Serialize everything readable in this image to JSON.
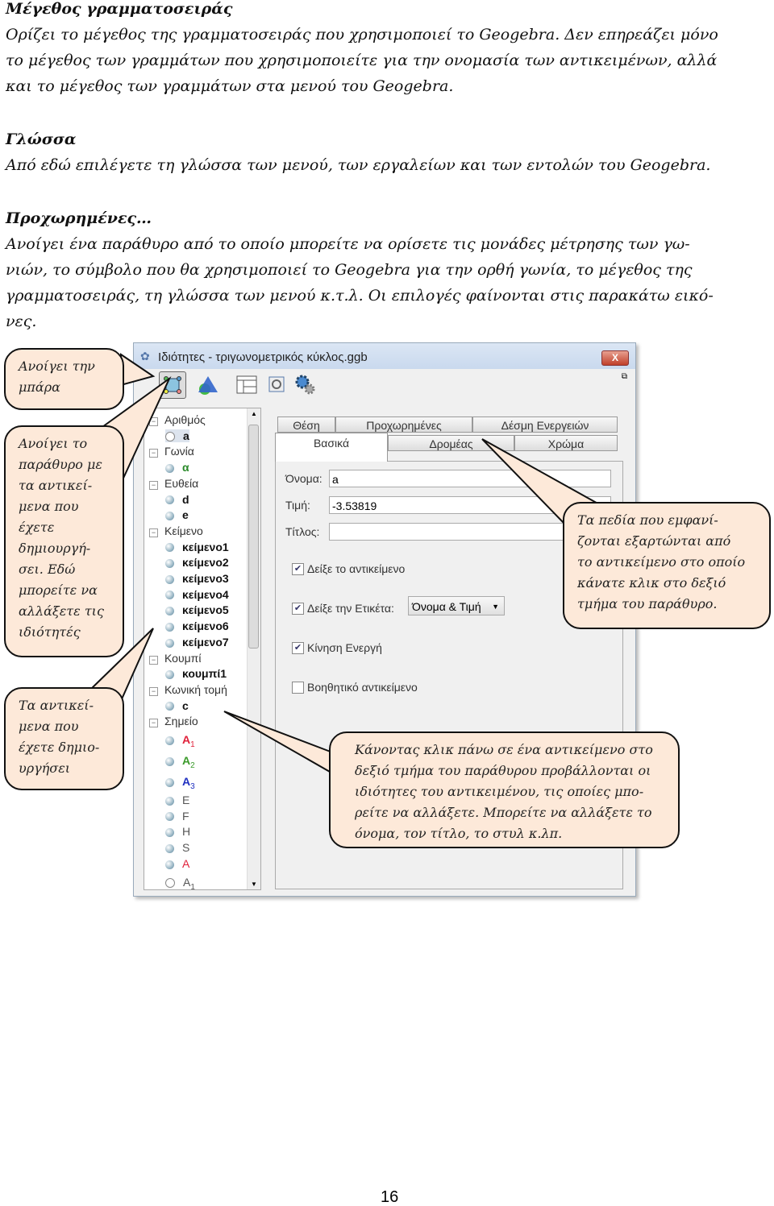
{
  "doc": {
    "font_heading": "Μέγεθος γραμματοσειράς",
    "font_lines": [
      "Ορίζει το μέγεθος της γραμματοσειράς που χρησιμοποιεί το Geogebra. Δεν επηρεάζει μόνο",
      "το μέγεθος των γραμμάτων που χρησιμοποιείτε για την ονομασία των αντικειμένων, αλλά",
      "και το μέγεθος των γραμμάτων στα μενού του Geogebra."
    ],
    "lang_heading": "Γλώσσα",
    "lang_lines": [
      "Από εδώ επιλέγετε τη γλώσσα των μενού, των εργαλείων και των εντολών του Geogebra."
    ],
    "adv_heading": "Προχωρημένες…",
    "adv_lines": [
      "Ανοίγει ένα παράθυρο από το οποίο μπορείτε να ορίσετε τις μονάδες μέτρησης των γω-",
      "νιών, το σύμβολο που θα χρησιμοποιεί το Geogebra για την ορθή γωνία, το μέγεθος της",
      "γραμματοσειράς, τη γλώσσα των μενού κ.τ.λ. Οι επιλογές φαίνονται στις παρακάτω εικό-",
      "νες."
    ],
    "page_number": "16"
  },
  "window": {
    "title": "Ιδιότητες - τριγωνομετρικός κύκλος.ggb",
    "close": "X",
    "tree": [
      {
        "label": "Αριθμός",
        "type": "group"
      },
      {
        "label": "a",
        "type": "item",
        "ball": "off",
        "selected": true
      },
      {
        "label": "Γωνία",
        "type": "group"
      },
      {
        "label": "α",
        "type": "item",
        "color": "#2a8a2a"
      },
      {
        "label": "Ευθεία",
        "type": "group"
      },
      {
        "label": "d",
        "type": "item"
      },
      {
        "label": "e",
        "type": "item"
      },
      {
        "label": "Κείμενο",
        "type": "group"
      },
      {
        "label": "κείμενο1",
        "type": "item"
      },
      {
        "label": "κείμενο2",
        "type": "item"
      },
      {
        "label": "κείμενο3",
        "type": "item"
      },
      {
        "label": "κείμενο4",
        "type": "item"
      },
      {
        "label": "κείμενο5",
        "type": "item"
      },
      {
        "label": "κείμενο6",
        "type": "item"
      },
      {
        "label": "κείμενο7",
        "type": "item"
      },
      {
        "label": "Κουμπί",
        "type": "group"
      },
      {
        "label": "κουμπί1",
        "type": "item"
      },
      {
        "label": "Κωνική τομή",
        "type": "group"
      },
      {
        "label": "c",
        "type": "item"
      },
      {
        "label": "Σημείο",
        "type": "group"
      },
      {
        "label": "A",
        "sub": "1",
        "type": "item",
        "color": "#e0203a"
      },
      {
        "label": "A",
        "sub": "2",
        "type": "item",
        "color": "#3a9a2a"
      },
      {
        "label": "A",
        "sub": "3",
        "type": "item",
        "color": "#2030c0"
      },
      {
        "label": "E",
        "type": "item",
        "color": "#555",
        "normal": true
      },
      {
        "label": "F",
        "type": "item",
        "color": "#555",
        "normal": true
      },
      {
        "label": "H",
        "type": "item",
        "color": "#555",
        "normal": true
      },
      {
        "label": "S",
        "type": "item",
        "color": "#555",
        "normal": true
      },
      {
        "label": "A",
        "type": "item",
        "color": "#e0203a",
        "normal": true
      },
      {
        "label": "A",
        "sub": "1",
        "type": "item",
        "ball": "off",
        "color": "#555",
        "normal": true
      }
    ],
    "tabs_back": [
      "Θέση",
      "Προχωρημένες",
      "Δέσμη Ενεργειών"
    ],
    "tabs_front": [
      "Βασικά",
      "Δρομέας",
      "Χρώμα"
    ],
    "form": {
      "name_label": "Όνομα:",
      "name_value": "a",
      "value_label": "Τιμή:",
      "value_value": "-3.53819",
      "caption_label": "Τίτλος:",
      "caption_value": "",
      "show_object": "Δείξε το αντικείμενο",
      "show_object_checked": true,
      "show_label": "Δείξε την Ετικέτα:",
      "show_label_checked": true,
      "label_mode": "Όνομα & Τιμή",
      "animation": "Κίνηση Ενεργή",
      "animation_checked": true,
      "auxiliary": "Βοηθητικό αντικείμενο",
      "auxiliary_checked": false
    }
  },
  "callouts": {
    "bar": [
      "Ανοίγει την",
      "μπάρα"
    ],
    "window": [
      "Ανοίγει το",
      "παράθυρο με",
      "τα αντικεί-",
      "μενα που",
      "έχετε",
      "δημιουργή-",
      "σει. Εδώ",
      "μπορείτε να",
      "αλλάξετε τις",
      "ιδιότητές"
    ],
    "objects": [
      "Τα αντικεί-",
      "μενα που",
      "έχετε δημιο-",
      "υργήσει"
    ],
    "fields": [
      "Τα πεδία που εμφανί-",
      "ζονται εξαρτώνται από",
      "το αντικείμενο στο οποίο",
      "κάνατε κλικ στο δεξιό",
      "τμήμα του παράθυρο."
    ],
    "click": [
      "Κάνοντας κλικ πάνω σε ένα αντικείμενο στο",
      "δεξιό τμήμα του παράθυρου προβάλλονται οι",
      "ιδιότητες του αντικειμένου, τις οποίες μπο-",
      "ρείτε να αλλάξετε. Μπορείτε να αλλάξετε το",
      "όνομα, τον τίτλο, το στυλ κ.λπ."
    ]
  },
  "colors": {
    "callout_fill": "#fde9d9",
    "titlebar": "#c9d9ee"
  }
}
